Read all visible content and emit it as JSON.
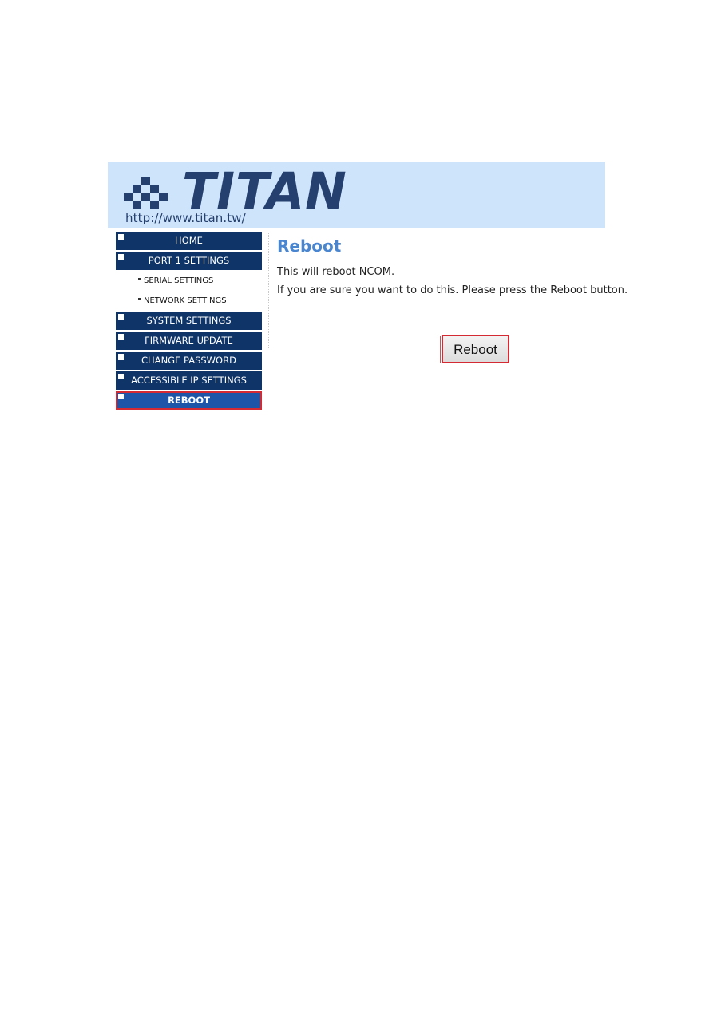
{
  "header": {
    "brand": "TITAN",
    "url": "http://www.titan.tw/",
    "logo_icon": "checkerboard-diamond-icon"
  },
  "sidebar": {
    "items": [
      {
        "label": "HOME",
        "type": "menu"
      },
      {
        "label": "PORT 1 SETTINGS",
        "type": "menu"
      },
      {
        "label": "SERIAL SETTINGS",
        "type": "sub"
      },
      {
        "label": "NETWORK SETTINGS",
        "type": "sub"
      },
      {
        "label": "SYSTEM SETTINGS",
        "type": "menu"
      },
      {
        "label": "FIRMWARE UPDATE",
        "type": "menu"
      },
      {
        "label": "CHANGE PASSWORD",
        "type": "menu"
      },
      {
        "label": "ACCESSIBLE IP SETTINGS",
        "type": "menu"
      },
      {
        "label": "REBOOT",
        "type": "menu",
        "active": true
      }
    ]
  },
  "content": {
    "title": "Reboot",
    "line1": "This will reboot NCOM.",
    "line2": "If you are sure you want to do this. Please press the Reboot button.",
    "button_label": "Reboot"
  },
  "colors": {
    "header_bg": "#cde4fb",
    "brand": "#253f6e",
    "menu_bg": "#0f3468",
    "menu_active_bg": "#1d56a9",
    "highlight_border": "#d42a33",
    "title": "#4a86cf"
  }
}
